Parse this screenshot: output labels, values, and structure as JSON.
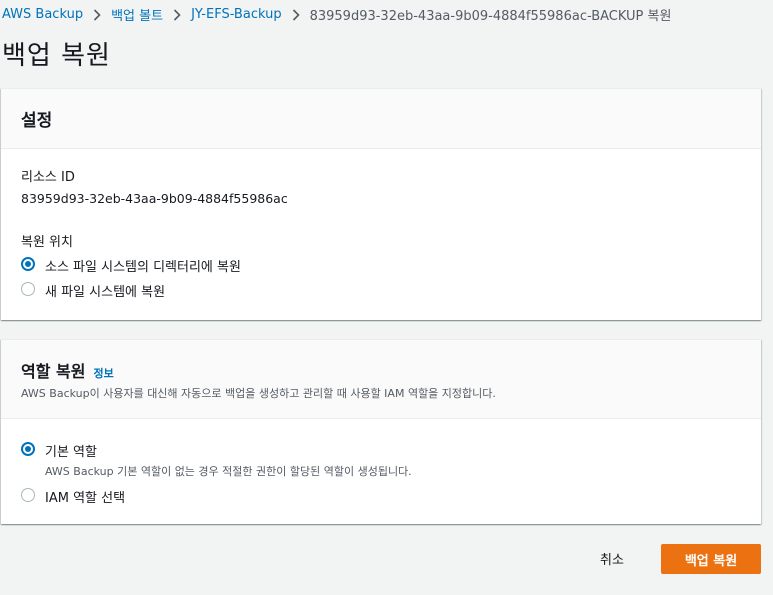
{
  "breadcrumb": {
    "items": [
      "AWS Backup",
      "백업 볼트",
      "JY-EFS-Backup"
    ],
    "current": "83959d93-32eb-43aa-9b09-4884f55986ac-BACKUP 복원"
  },
  "page_title": "백업 복원",
  "settings": {
    "title": "설정",
    "resource_id_label": "리소스 ID",
    "resource_id_value": "83959d93-32eb-43aa-9b09-4884f55986ac",
    "restore_location_label": "복원 위치",
    "options": [
      {
        "label": "소스 파일 시스템의 디렉터리에 복원",
        "selected": true
      },
      {
        "label": "새 파일 시스템에 복원",
        "selected": false
      }
    ]
  },
  "role": {
    "title": "역할 복원",
    "info": "정보",
    "description": "AWS Backup이 사용자를 대신해 자동으로 백업을 생성하고 관리할 때 사용할 IAM 역할을 지정합니다.",
    "options": [
      {
        "label": "기본 역할",
        "description": "AWS Backup 기본 역할이 없는 경우 적절한 권한이 할당된 역할이 생성됩니다.",
        "selected": true
      },
      {
        "label": "IAM 역할 선택",
        "selected": false
      }
    ]
  },
  "actions": {
    "cancel": "취소",
    "submit": "백업 복원"
  },
  "colors": {
    "accent": "#0073bb",
    "primary_button": "#ec7211",
    "background": "#f2f3f3"
  }
}
